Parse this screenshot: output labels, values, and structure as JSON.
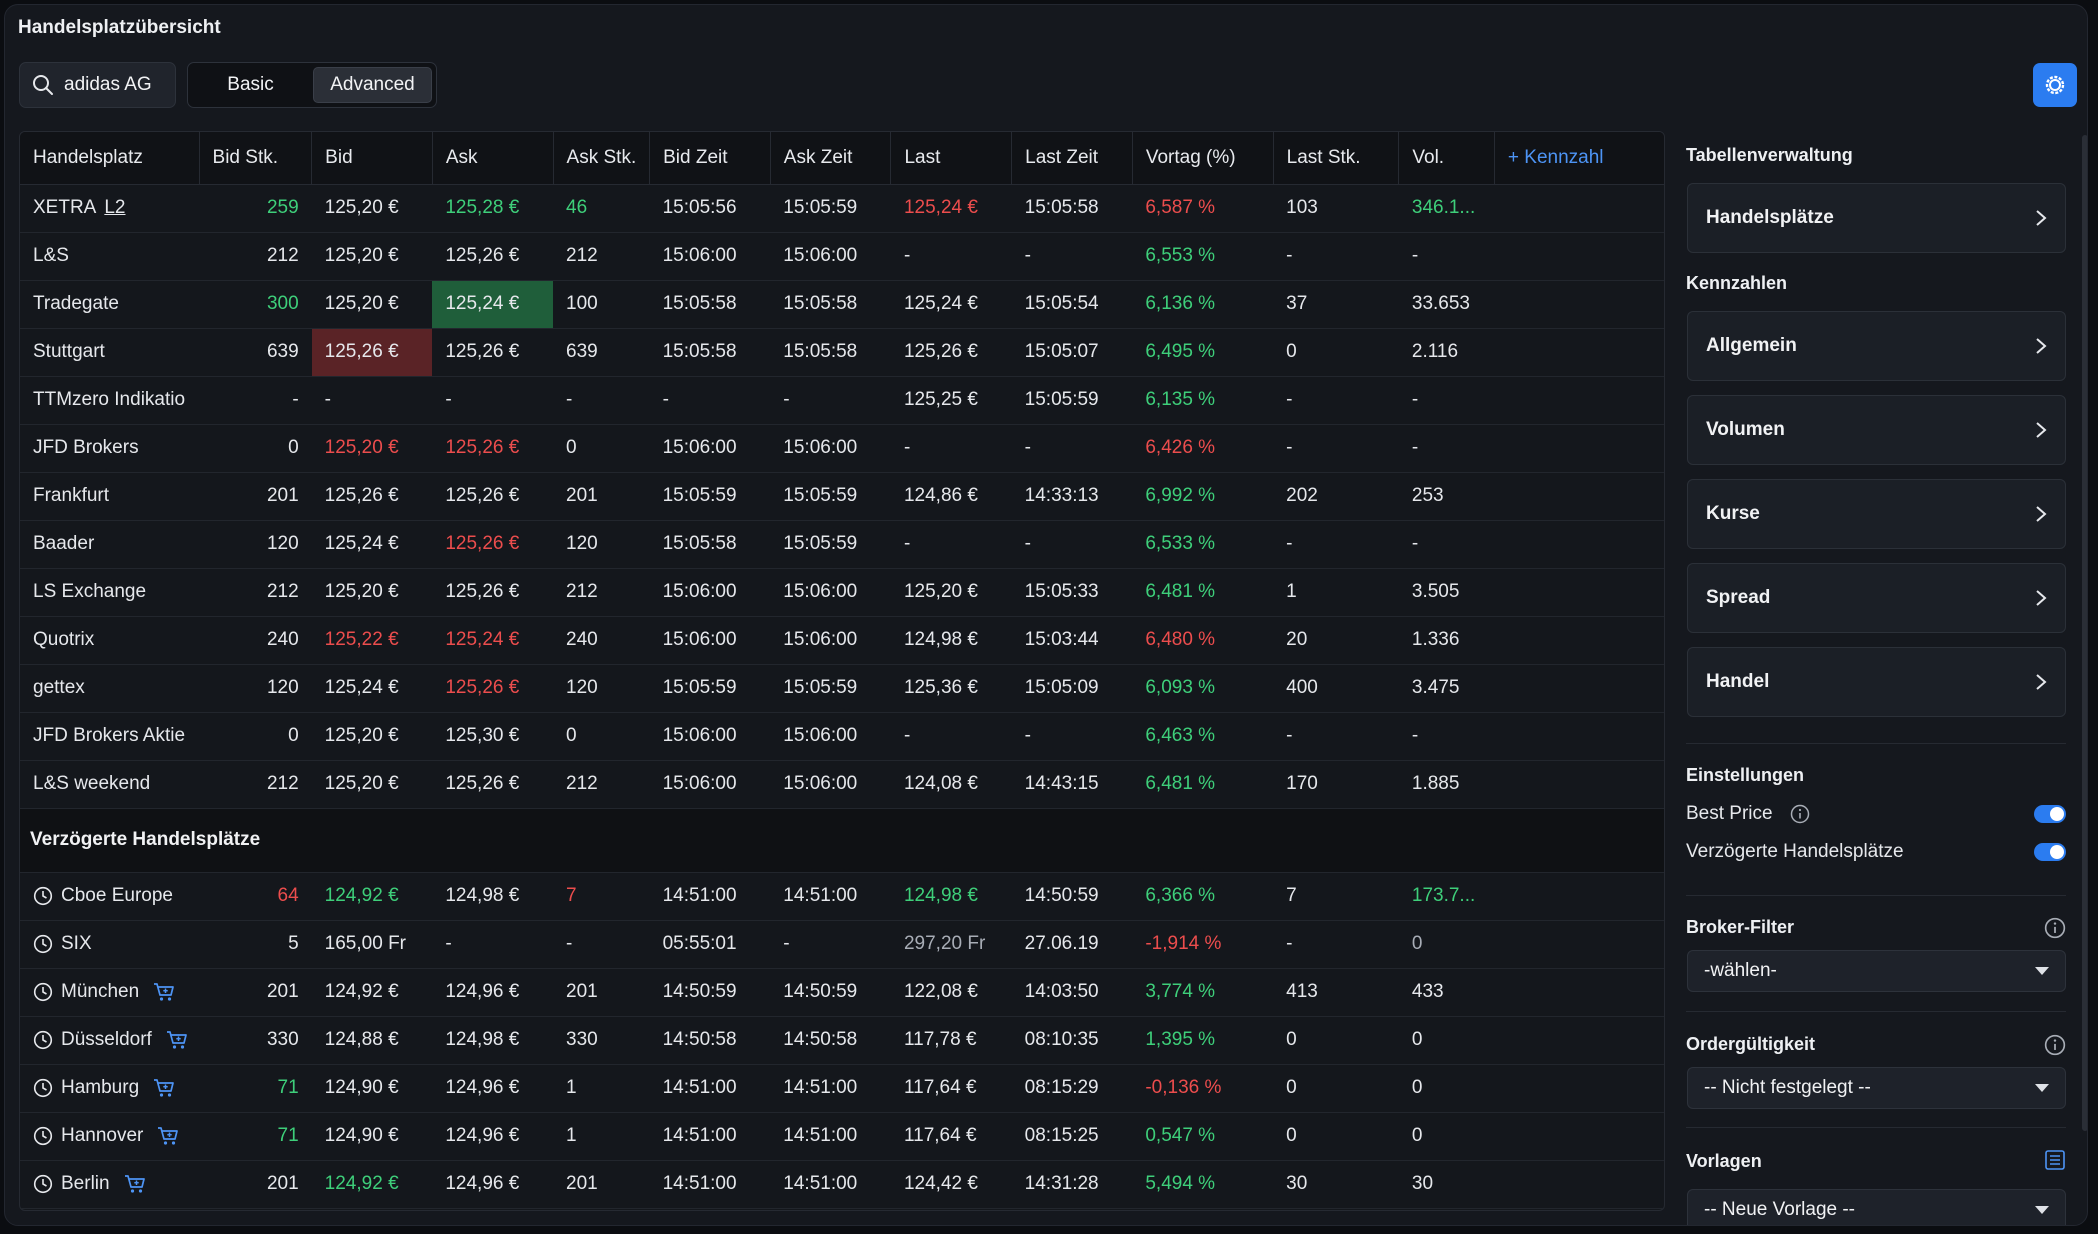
{
  "title": "Handelsplatzübersicht",
  "search": {
    "value": "adidas AG"
  },
  "modes": [
    "Basic",
    "Advanced"
  ],
  "active_mode": "Advanced",
  "colors": {
    "accent": "#2b7cf0",
    "positive": "#3ecf7a",
    "negative": "#ec4d4d"
  },
  "table": {
    "columns": [
      "Handelsplatz",
      "Bid Stk.",
      "Bid",
      "Ask",
      "Ask Stk.",
      "Bid Zeit",
      "Ask Zeit",
      "Last",
      "Last Zeit",
      "Vortag (%)",
      "Last Stk.",
      "Vol."
    ],
    "add_column_label": "+  Kennzahl",
    "rows": [
      {
        "name": "XETRA",
        "tag": "L2",
        "bid_stk": "259",
        "bid": "125,20 €",
        "ask": "125,28 €",
        "ask_stk": "46",
        "bid_zeit": "15:05:56",
        "ask_zeit": "15:05:59",
        "last": "125,24 €",
        "last_zeit": "15:05:58",
        "vortag": "6,587 %",
        "last_stk": "103",
        "vol": "346.1..."
      },
      {
        "name": "L&S",
        "bid_stk": "212",
        "bid": "125,20 €",
        "ask": "125,26 €",
        "ask_stk": "212",
        "bid_zeit": "15:06:00",
        "ask_zeit": "15:06:00",
        "last": "-",
        "last_zeit": "-",
        "vortag": "6,553 %",
        "last_stk": "-",
        "vol": "-"
      },
      {
        "name": "Tradegate",
        "bid_stk": "300",
        "bid": "125,20 €",
        "ask": "125,24 €",
        "ask_stk": "100",
        "bid_zeit": "15:05:58",
        "ask_zeit": "15:05:58",
        "last": "125,24 €",
        "last_zeit": "15:05:54",
        "vortag": "6,136 %",
        "last_stk": "37",
        "vol": "33.653"
      },
      {
        "name": "Stuttgart",
        "bid_stk": "639",
        "bid": "125,26 €",
        "ask": "125,26 €",
        "ask_stk": "639",
        "bid_zeit": "15:05:58",
        "ask_zeit": "15:05:58",
        "last": "125,26 €",
        "last_zeit": "15:05:07",
        "vortag": "6,495 %",
        "last_stk": "0",
        "vol": "2.116"
      },
      {
        "name": "TTMzero Indikatio",
        "bid_stk": "-",
        "bid": "-",
        "ask": "-",
        "ask_stk": "-",
        "bid_zeit": "-",
        "ask_zeit": "-",
        "last": "125,25 €",
        "last_zeit": "15:05:59",
        "vortag": "6,135 %",
        "last_stk": "-",
        "vol": "-"
      },
      {
        "name": "JFD Brokers",
        "bid_stk": "0",
        "bid": "125,20 €",
        "ask": "125,26 €",
        "ask_stk": "0",
        "bid_zeit": "15:06:00",
        "ask_zeit": "15:06:00",
        "last": "-",
        "last_zeit": "-",
        "vortag": "6,426 %",
        "last_stk": "-",
        "vol": "-"
      },
      {
        "name": "Frankfurt",
        "bid_stk": "201",
        "bid": "125,26 €",
        "ask": "125,26 €",
        "ask_stk": "201",
        "bid_zeit": "15:05:59",
        "ask_zeit": "15:05:59",
        "last": "124,86 €",
        "last_zeit": "14:33:13",
        "vortag": "6,992 %",
        "last_stk": "202",
        "vol": "253"
      },
      {
        "name": "Baader",
        "bid_stk": "120",
        "bid": "125,24 €",
        "ask": "125,26 €",
        "ask_stk": "120",
        "bid_zeit": "15:05:58",
        "ask_zeit": "15:05:59",
        "last": "-",
        "last_zeit": "-",
        "vortag": "6,533 %",
        "last_stk": "-",
        "vol": "-"
      },
      {
        "name": "LS Exchange",
        "bid_stk": "212",
        "bid": "125,20 €",
        "ask": "125,26 €",
        "ask_stk": "212",
        "bid_zeit": "15:06:00",
        "ask_zeit": "15:06:00",
        "last": "125,20 €",
        "last_zeit": "15:05:33",
        "vortag": "6,481 %",
        "last_stk": "1",
        "vol": "3.505"
      },
      {
        "name": "Quotrix",
        "bid_stk": "240",
        "bid": "125,22 €",
        "ask": "125,24 €",
        "ask_stk": "240",
        "bid_zeit": "15:06:00",
        "ask_zeit": "15:06:00",
        "last": "124,98 €",
        "last_zeit": "15:03:44",
        "vortag": "6,480 %",
        "last_stk": "20",
        "vol": "1.336"
      },
      {
        "name": "gettex",
        "bid_stk": "120",
        "bid": "125,24 €",
        "ask": "125,26 €",
        "ask_stk": "120",
        "bid_zeit": "15:05:59",
        "ask_zeit": "15:05:59",
        "last": "125,36 €",
        "last_zeit": "15:05:09",
        "vortag": "6,093 %",
        "last_stk": "400",
        "vol": "3.475"
      },
      {
        "name": "JFD Brokers Aktie",
        "bid_stk": "0",
        "bid": "125,20 €",
        "ask": "125,30 €",
        "ask_stk": "0",
        "bid_zeit": "15:06:00",
        "ask_zeit": "15:06:00",
        "last": "-",
        "last_zeit": "-",
        "vortag": "6,463 %",
        "last_stk": "-",
        "vol": "-"
      },
      {
        "name": "L&S weekend",
        "bid_stk": "212",
        "bid": "125,20 €",
        "ask": "125,26 €",
        "ask_stk": "212",
        "bid_zeit": "15:06:00",
        "ask_zeit": "15:06:00",
        "last": "124,08 €",
        "last_zeit": "14:43:15",
        "vortag": "6,481 %",
        "last_stk": "170",
        "vol": "1.885"
      }
    ],
    "delayed_section_label": "Verzögerte Handelsplätze",
    "delayed_rows": [
      {
        "name": "Cboe Europe",
        "bid_stk": "64",
        "bid": "124,92 €",
        "ask": "124,98 €",
        "ask_stk": "7",
        "bid_zeit": "14:51:00",
        "ask_zeit": "14:51:00",
        "last": "124,98 €",
        "last_zeit": "14:50:59",
        "vortag": "6,366 %",
        "last_stk": "7",
        "vol": "173.7..."
      },
      {
        "name": "SIX",
        "bid_stk": "5",
        "bid": "165,00 Fr",
        "ask": "-",
        "ask_stk": "-",
        "bid_zeit": "05:55:01",
        "ask_zeit": "-",
        "last": "297,20 Fr",
        "last_zeit": "27.06.19",
        "vortag": "-1,914 %",
        "last_stk": "-",
        "vol": "0"
      },
      {
        "name": "München",
        "bid_stk": "201",
        "bid": "124,92 €",
        "ask": "124,96 €",
        "ask_stk": "201",
        "bid_zeit": "14:50:59",
        "ask_zeit": "14:50:59",
        "last": "122,08 €",
        "last_zeit": "14:03:50",
        "vortag": "3,774 %",
        "last_stk": "413",
        "vol": "433"
      },
      {
        "name": "Düsseldorf",
        "bid_stk": "330",
        "bid": "124,88 €",
        "ask": "124,98 €",
        "ask_stk": "330",
        "bid_zeit": "14:50:58",
        "ask_zeit": "14:50:58",
        "last": "117,78 €",
        "last_zeit": "08:10:35",
        "vortag": "1,395 %",
        "last_stk": "0",
        "vol": "0"
      },
      {
        "name": "Hamburg",
        "bid_stk": "71",
        "bid": "124,90 €",
        "ask": "124,96 €",
        "ask_stk": "1",
        "bid_zeit": "14:51:00",
        "ask_zeit": "14:51:00",
        "last": "117,64 €",
        "last_zeit": "08:15:29",
        "vortag": "-0,136 %",
        "last_stk": "0",
        "vol": "0"
      },
      {
        "name": "Hannover",
        "bid_stk": "71",
        "bid": "124,90 €",
        "ask": "124,96 €",
        "ask_stk": "1",
        "bid_zeit": "14:51:00",
        "ask_zeit": "14:51:00",
        "last": "117,64 €",
        "last_zeit": "08:15:25",
        "vortag": "0,547 %",
        "last_stk": "0",
        "vol": "0"
      },
      {
        "name": "Berlin",
        "bid_stk": "201",
        "bid": "124,92 €",
        "ask": "124,96 €",
        "ask_stk": "201",
        "bid_zeit": "14:51:00",
        "ask_zeit": "14:51:00",
        "last": "124,42 €",
        "last_zeit": "14:31:28",
        "vortag": "5,494 %",
        "last_stk": "30",
        "vol": "30"
      }
    ]
  },
  "panel": {
    "table_mgmt": {
      "title": "Tabellenverwaltung",
      "items": [
        "Handelsplätze"
      ]
    },
    "kennzahlen": {
      "title": "Kennzahlen",
      "items": [
        "Allgemein",
        "Volumen",
        "Kurse",
        "Spread",
        "Handel"
      ]
    },
    "settings": {
      "title": "Einstellungen",
      "best_price": "Best Price",
      "delayed": "Verzögerte Handelsplätze"
    },
    "broker_filter": {
      "title": "Broker-Filter",
      "value": "-wählen-"
    },
    "order_validity": {
      "title": "Ordergültigkeit",
      "value": "-- Nicht festgelegt --"
    },
    "templates": {
      "title": "Vorlagen",
      "value": "-- Neue Vorlage --"
    }
  }
}
